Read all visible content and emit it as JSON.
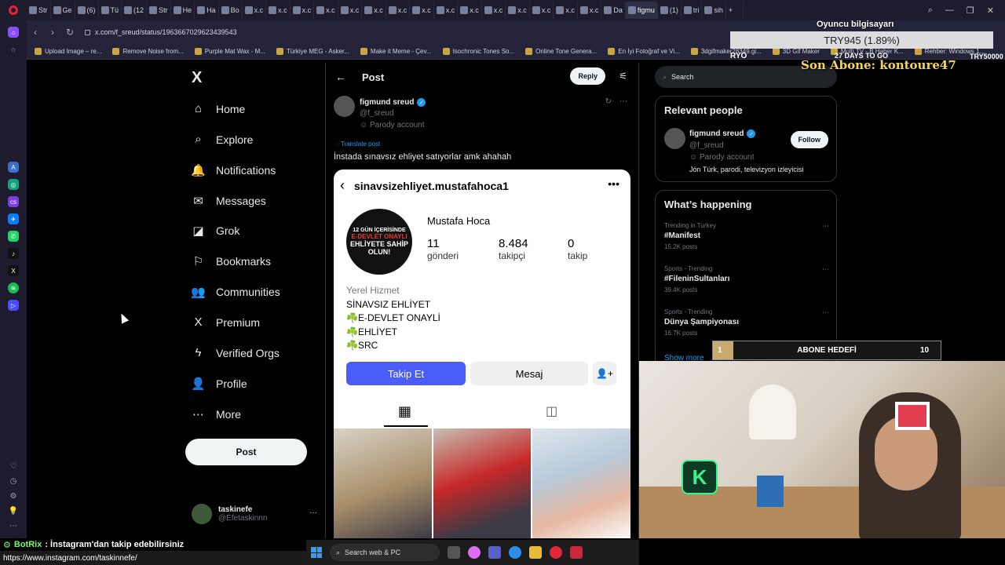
{
  "browser": {
    "tabs": [
      "Str",
      "Ge",
      "(6)",
      "Tü",
      "(12",
      "Str",
      "He",
      "Ha",
      "Bo",
      "x.c",
      "x.c",
      "x.c",
      "x.c",
      "x.c",
      "x.c",
      "x.c",
      "x.c",
      "x.c",
      "x.c",
      "x.c",
      "x.c",
      "x.c",
      "x.c",
      "x.c",
      "Da",
      "figmu",
      "(1)",
      "tri",
      "sih"
    ],
    "active_tab": "figmu",
    "new_tab_label": "+",
    "url": "x.com/f_sreud/status/1963667029623439543",
    "bookmarks": [
      "Upload Image – re...",
      "Remove Noise from...",
      "Purple Mat Wax - M...",
      "Türkiye MEG - Asker...",
      "Make it Meme - Çev...",
      "Isochronic Tones So...",
      "Online Tone Genera...",
      "En İyi Fotoğraf ve Vi...",
      "3dgifmaker28349.gi...",
      "3D Gif Maker",
      "Multi TV - B Haber K...",
      "Rehber: Windows 1..."
    ]
  },
  "xnav": {
    "logo": "X",
    "items": [
      {
        "label": "Home",
        "icon": "⌂"
      },
      {
        "label": "Explore",
        "icon": "⌕"
      },
      {
        "label": "Notifications",
        "icon": "🔔"
      },
      {
        "label": "Messages",
        "icon": "✉"
      },
      {
        "label": "Grok",
        "icon": "◪"
      },
      {
        "label": "Bookmarks",
        "icon": "⚐"
      },
      {
        "label": "Communities",
        "icon": "👥"
      },
      {
        "label": "Premium",
        "icon": "X"
      },
      {
        "label": "Verified Orgs",
        "icon": "ϟ"
      },
      {
        "label": "Profile",
        "icon": "👤"
      },
      {
        "label": "More",
        "icon": "⋯"
      }
    ],
    "post_label": "Post",
    "account": {
      "name": "taskinefe",
      "handle": "@Efetaskinnn",
      "more": "···"
    }
  },
  "post": {
    "back": "←",
    "title": "Post",
    "reply_label": "Reply",
    "author_name": "figmund sreud",
    "author_handle": "@f_sreud",
    "parody_label": "Parody account",
    "translate_label": "Translate post",
    "text": "İnstada sınavsız ehliyet satıyorlar amk ahahah",
    "instagram": {
      "username": "sinavsizehliyet.mustafahoca1",
      "pfp_line1": "12 GÜN İÇERİSİNDE",
      "pfp_line2": "E-DEVLET ONAYLI",
      "pfp_line3": "EHLİYETE SAHİP OLUN!",
      "display_name": "Mustafa Hoca",
      "stats": [
        {
          "num": "11",
          "label": "gönderi"
        },
        {
          "num": "8.484",
          "label": "takipçi"
        },
        {
          "num": "0",
          "label": "takip"
        }
      ],
      "category": "Yerel Hizmet",
      "bio": [
        "SİNAVSIZ EHLİYET",
        "☘️E-DEVLET ONAYLİ",
        "☘️EHLİYET",
        "☘️SRC"
      ],
      "follow_label": "Takip Et",
      "message_label": "Mesaj"
    }
  },
  "right": {
    "search_placeholder": "Search",
    "relevant_title": "Relevant people",
    "rel_name": "figmund sreud",
    "rel_handle": "@f_sreud",
    "rel_parody": "Parody account",
    "rel_bio": "Jön Türk, parodi, televizyon izleyicisi",
    "follow_label": "Follow",
    "happening_title": "What’s happening",
    "trends": [
      {
        "meta": "Trending in Turkey",
        "title": "#Manifest",
        "count": "15.2K posts"
      },
      {
        "meta": "Sports · Trending",
        "title": "#FileninSultanları",
        "count": "39.4K posts"
      },
      {
        "meta": "Sports · Trending",
        "title": "Dünya Şampiyonası",
        "count": "16.7K posts"
      }
    ],
    "show_more": "Show more"
  },
  "overlay": {
    "oyuncu": "Oyuncu bilgisayarı",
    "try": "TRY945 (1.89%)",
    "ryo": "RYO",
    "days": "27 DAYS TO GO",
    "try_goal": "TRY50000",
    "son_abone": "Son Abone: kontoure47",
    "goal_start": "1",
    "goal_label": "ABONE HEDEFİ",
    "goal_end": "10"
  },
  "chat": {
    "bot": "BotRix",
    "message": ": İnstagram'dan takip edebilirsiniz",
    "link": "https://www.instagram.com/taskinnefe/"
  },
  "taskbar": {
    "search": "Search web & PC"
  }
}
